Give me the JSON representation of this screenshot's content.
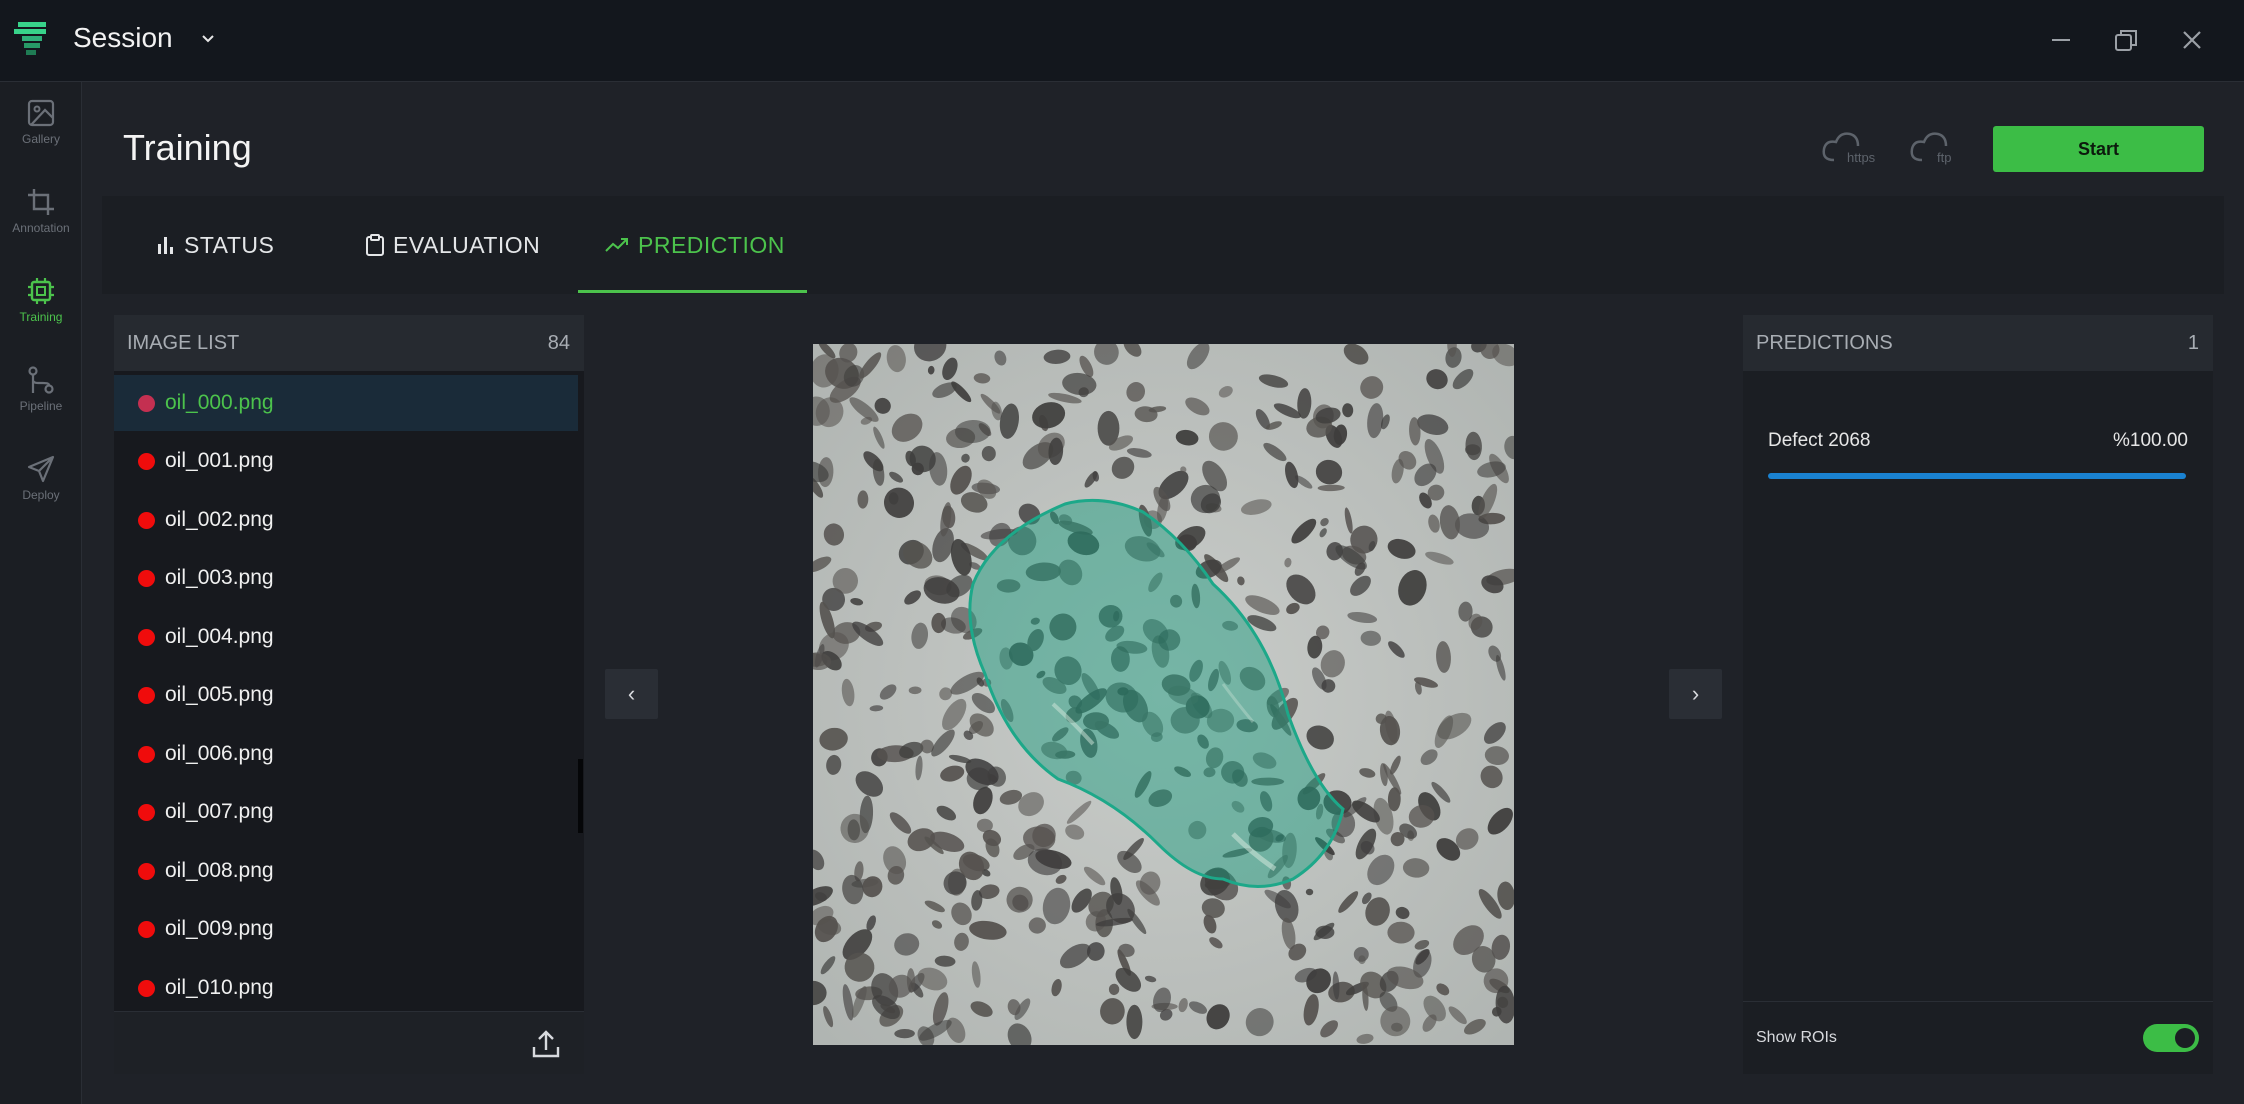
{
  "app": {
    "session_title": "Session"
  },
  "sidebar": {
    "items": [
      {
        "label": "Gallery",
        "icon": "image-icon"
      },
      {
        "label": "Annotation",
        "icon": "crop-icon"
      },
      {
        "label": "Training",
        "icon": "cpu-icon",
        "active": true
      },
      {
        "label": "Pipeline",
        "icon": "git-branch-icon"
      },
      {
        "label": "Deploy",
        "icon": "send-icon"
      }
    ]
  },
  "header": {
    "title": "Training",
    "cloud_https": "https",
    "cloud_ftp": "ftp",
    "start_label": "Start"
  },
  "tabs": [
    {
      "label": "STATUS",
      "icon": "bar-chart-icon"
    },
    {
      "label": "EVALUATION",
      "icon": "clipboard-icon"
    },
    {
      "label": "PREDICTION",
      "icon": "trending-up-icon",
      "active": true
    }
  ],
  "image_list": {
    "title": "IMAGE LIST",
    "count": "84",
    "items": [
      "oil_000.png",
      "oil_001.png",
      "oil_002.png",
      "oil_003.png",
      "oil_004.png",
      "oil_005.png",
      "oil_006.png",
      "oil_007.png",
      "oil_008.png",
      "oil_009.png",
      "oil_010.png"
    ],
    "selected_index": 0
  },
  "viewer": {
    "prev": "‹",
    "next": "›"
  },
  "predictions": {
    "title": "PREDICTIONS",
    "count": "1",
    "items": [
      {
        "label": "Defect 2068",
        "score": "%100.00",
        "fraction": 1.0
      }
    ],
    "show_rois_label": "Show ROIs",
    "show_rois": true
  },
  "colors": {
    "accent": "#3cbd46",
    "bar": "#1a82d1",
    "dot": "#f00c0c"
  }
}
